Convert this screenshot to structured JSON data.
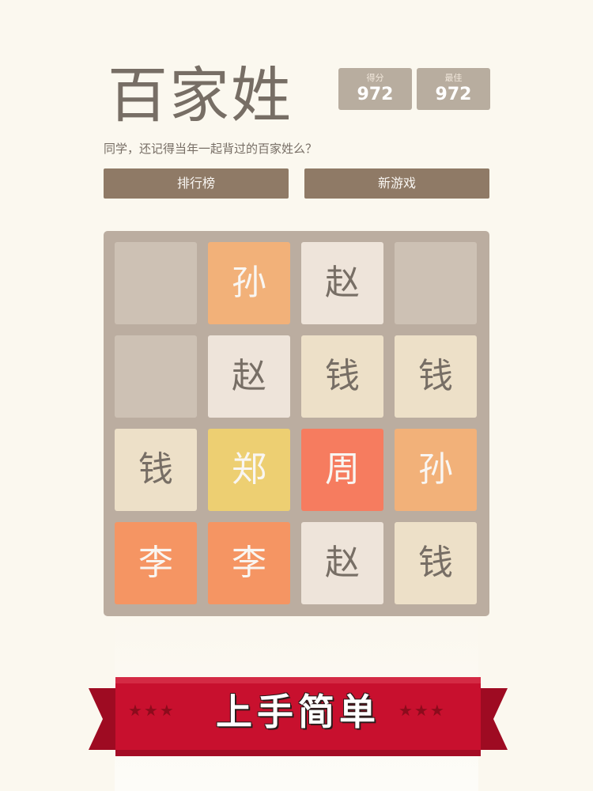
{
  "header": {
    "title": "百家姓",
    "subtitle": "同学，还记得当年一起背过的百家姓么？"
  },
  "scores": {
    "current_label": "得分",
    "current_value": "972",
    "best_label": "最佳",
    "best_value": "972"
  },
  "buttons": {
    "leaderboard": "排行榜",
    "new_game": "新游戏"
  },
  "board": {
    "rows": [
      [
        null,
        "孙",
        "赵",
        null
      ],
      [
        null,
        "赵",
        "钱",
        "钱"
      ],
      [
        "钱",
        "郑",
        "周",
        "孙"
      ],
      [
        "李",
        "李",
        "赵",
        "钱"
      ]
    ]
  },
  "tile_styles": {
    "赵": {
      "bg": "#eee4da",
      "fg": "#776e65"
    },
    "钱": {
      "bg": "#ede0c8",
      "fg": "#776e65"
    },
    "孙": {
      "bg": "#f2b179",
      "fg": "#f9f6f2"
    },
    "李": {
      "bg": "#f59563",
      "fg": "#f9f6f2"
    },
    "周": {
      "bg": "#f67c5f",
      "fg": "#f9f6f2"
    },
    "郑": {
      "bg": "#edcf72",
      "fg": "#f9f6f2"
    },
    "empty": {
      "bg": "#cdc1b4"
    }
  },
  "banner": {
    "text": "上手简单",
    "stars_left": "★★★",
    "stars_right": "★★★",
    "color": "#c8102e"
  }
}
